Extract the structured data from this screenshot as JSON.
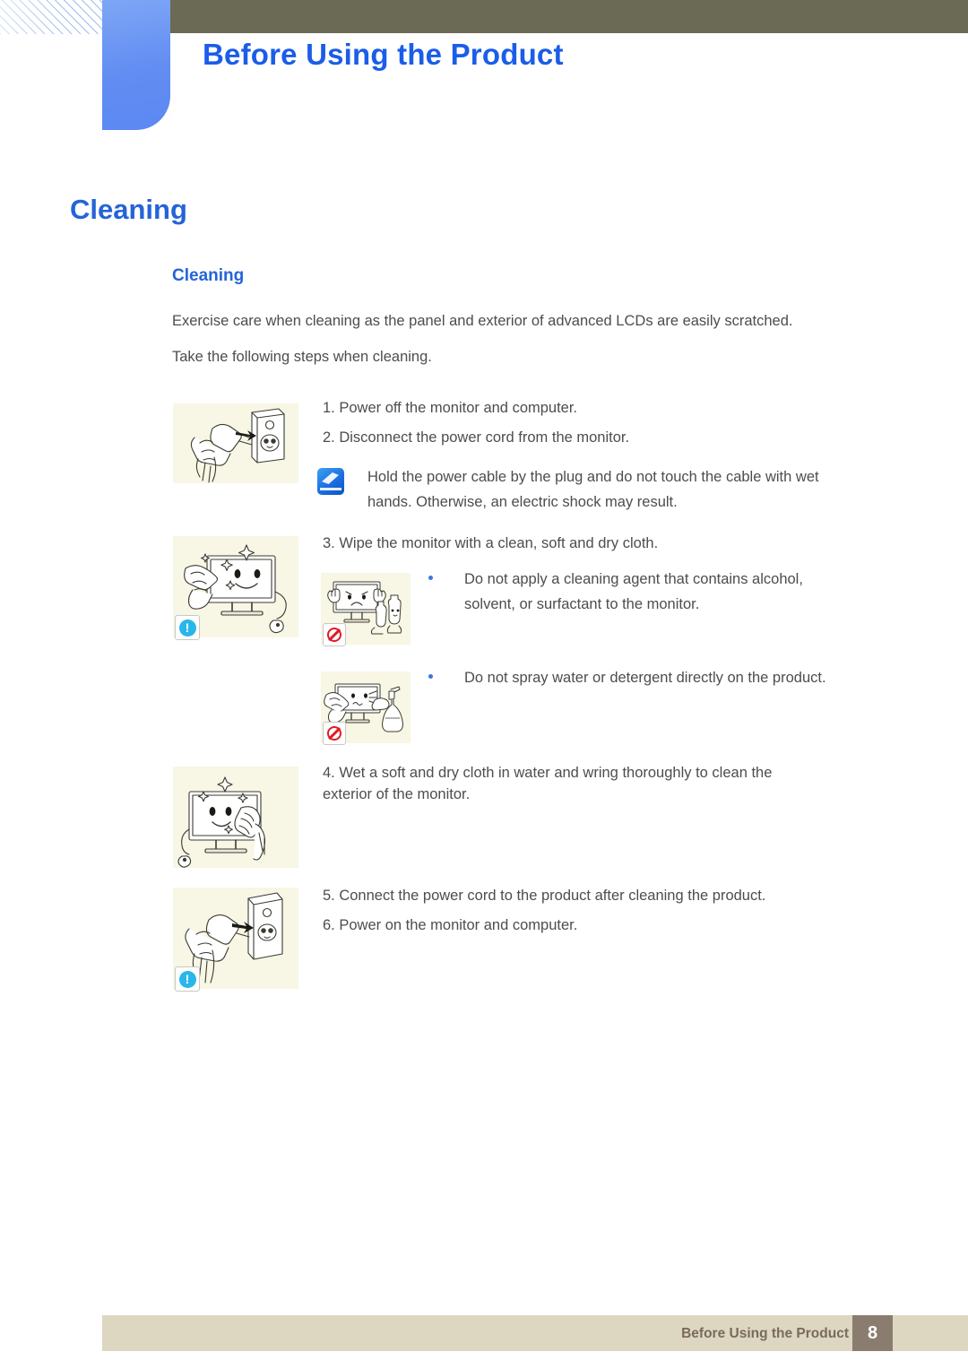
{
  "header": {
    "chapter_title": "Before Using the Product",
    "olive_bar_color": "#6b6a55",
    "tab_color": "#628df2",
    "title_color": "#1a5de8"
  },
  "headings": {
    "section_title": "Cleaning",
    "sub_title": "Cleaning",
    "color": "#2464d8"
  },
  "intro": {
    "line1": "Exercise care when cleaning as the panel and exterior of advanced LCDs are easily scratched.",
    "line2": "Take the following steps when cleaning."
  },
  "steps": {
    "step1": "1. Power off the monitor and computer.",
    "step2": "2. Disconnect the power cord from the monitor.",
    "step3": "3. Wipe the monitor with a clean, soft and dry cloth.",
    "step4": "4. Wet a soft and dry cloth in water and wring thoroughly to clean the exterior of the monitor.",
    "step5": "5. Connect the power cord to the product after cleaning the product.",
    "step6": "6. Power on the monitor and computer."
  },
  "note": {
    "icon": "note-pencil-icon",
    "text": "Hold the power cable by the plug and do not touch the cable with wet hands. Otherwise, an electric shock may result."
  },
  "bullets": [
    {
      "text": "Do not apply a cleaning agent that contains alcohol, solvent, or surfactant to the monitor.",
      "marker": "bullet-dot",
      "color": "#3a76dd"
    },
    {
      "text": "Do not spray water or detergent directly on the product.",
      "marker": "bullet-dot",
      "color": "#3a76dd"
    }
  ],
  "illustrations": [
    {
      "name": "unplug-power-cord-illustration",
      "badge": "none"
    },
    {
      "name": "wipe-monitor-with-cloth-illustration",
      "badge": "info-exclamation"
    },
    {
      "name": "no-cleaning-agent-illustration",
      "badge": "prohibited"
    },
    {
      "name": "no-spray-water-illustration",
      "badge": "prohibited"
    },
    {
      "name": "wet-cloth-clean-exterior-illustration",
      "badge": "none"
    },
    {
      "name": "reconnect-power-cord-illustration",
      "badge": "info-exclamation"
    }
  ],
  "badges": {
    "info_glyph": "!",
    "info_color": "#29b6e8",
    "prohibited_color": "#e01b24"
  },
  "footer": {
    "label": "Before Using the Product",
    "page_number": "8",
    "bar_color": "#ddd7c2",
    "page_box_color": "#8a7d70"
  }
}
